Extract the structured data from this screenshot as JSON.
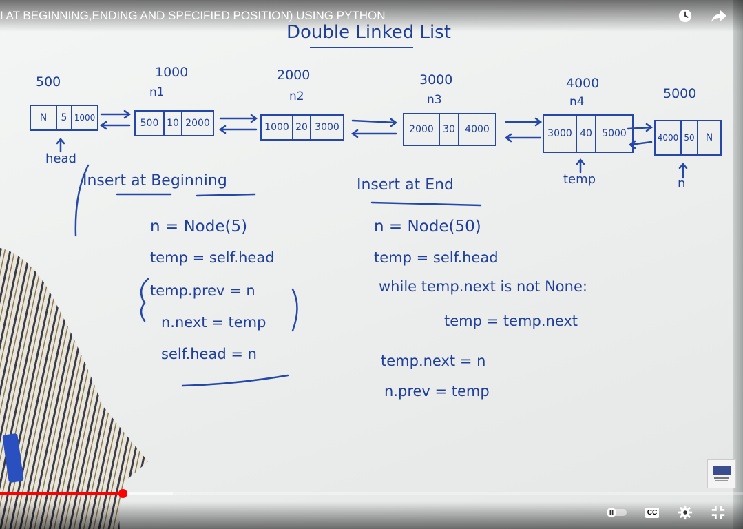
{
  "video": {
    "title": "I AT BEGINNING,ENDING AND SPECIFIED POSITION) USING PYTHON",
    "progress": 0.165,
    "buffered": 0.233
  },
  "board": {
    "heading": "Double Linked List",
    "addresses": [
      "500",
      "1000",
      "2000",
      "3000",
      "4000",
      "5000"
    ],
    "node_names": [
      "n1",
      "n2",
      "n3",
      "n4"
    ],
    "nodes": [
      [
        "N",
        "5",
        "1000"
      ],
      [
        "500",
        "10",
        "2000"
      ],
      [
        "1000",
        "20",
        "3000"
      ],
      [
        "2000",
        "30",
        "4000"
      ],
      [
        "3000",
        "40",
        "5000"
      ],
      [
        "4000",
        "50",
        "N"
      ]
    ],
    "pointer_labels": {
      "head": "head",
      "temp": "temp",
      "n": "n"
    },
    "left_section": {
      "title": "Insert at Beginning",
      "lines": [
        "n = Node(5)",
        "temp = self.head",
        "temp.prev = n",
        "n.next = temp",
        "self.head = n"
      ]
    },
    "right_section": {
      "title": "Insert at End",
      "lines": [
        "n = Node(50)",
        "temp = self.head",
        "while temp.next is not None:",
        "temp = temp.next",
        "temp.next = n",
        "n.prev = temp"
      ]
    }
  },
  "controls": {
    "cc_label": "CC",
    "icons": [
      "clock-icon",
      "share-icon",
      "pause-icon",
      "cc-icon",
      "settings-icon",
      "exit-fullscreen-icon"
    ]
  }
}
